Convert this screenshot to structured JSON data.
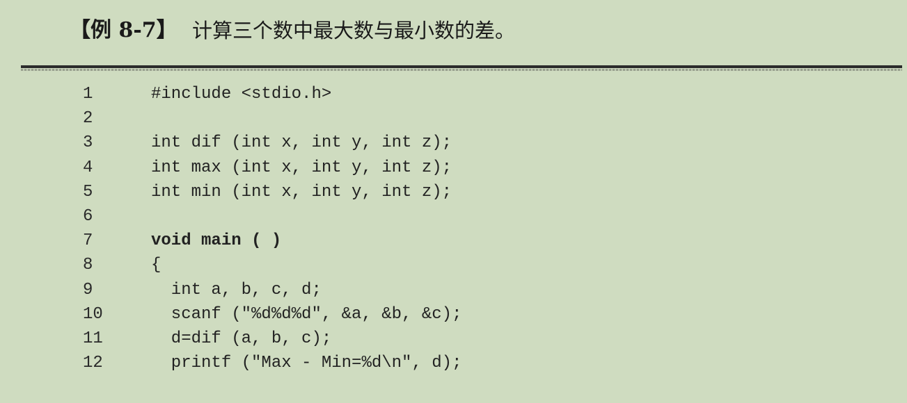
{
  "example": {
    "label": "【例 8-7】",
    "title": "计算三个数中最大数与最小数的差。"
  },
  "code_lines": [
    {
      "no": "1",
      "code": "#include <stdio.h>",
      "bold": false
    },
    {
      "no": "2",
      "code": "",
      "bold": false
    },
    {
      "no": "3",
      "code": "int dif (int x, int y, int z);",
      "bold": false
    },
    {
      "no": "4",
      "code": "int max (int x, int y, int z);",
      "bold": false
    },
    {
      "no": "5",
      "code": "int min (int x, int y, int z);",
      "bold": false
    },
    {
      "no": "6",
      "code": "",
      "bold": false
    },
    {
      "no": "7",
      "code": "void main ( )",
      "bold": true
    },
    {
      "no": "8",
      "code": "{",
      "bold": false
    },
    {
      "no": "9",
      "code": "  int a, b, c, d;",
      "bold": false
    },
    {
      "no": "10",
      "code": "  scanf (\"%d%d%d\", &a, &b, &c);",
      "bold": false
    },
    {
      "no": "11",
      "code": "  d=dif (a, b, c);",
      "bold": false
    },
    {
      "no": "12",
      "code": "  printf (\"Max - Min=%d\\n\", d);",
      "bold": false
    }
  ]
}
